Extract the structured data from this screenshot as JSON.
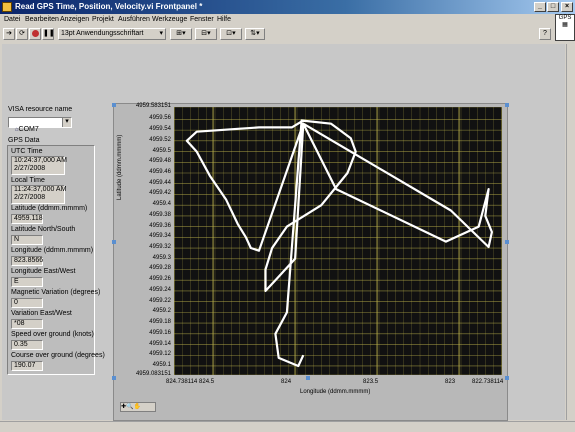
{
  "window": {
    "title": "Read GPS Time, Position, Velocity.vi Frontpanel *"
  },
  "menu": [
    "Datei",
    "Bearbeiten",
    "Anzeigen",
    "Projekt",
    "Ausführen",
    "Werkzeuge",
    "Fenster",
    "Hilfe"
  ],
  "toolbar": {
    "font_label": "13pt Anwendungsschriftart"
  },
  "visa": {
    "label": "VISA resource name",
    "value": "COM7"
  },
  "gps": {
    "cluster_label": "GPS Data",
    "utc_label": "UTC Time",
    "utc_time": "10:24:37,000 AM",
    "utc_date": "2/27/2008",
    "local_label": "Local Time",
    "local_time": "11:24:37,000 AM",
    "local_date": "2/27/2008",
    "lat_label": "Latitude (ddmm.mmmm)",
    "lat_value": "4959.118",
    "lat_ns_label": "Latitude North/South",
    "lat_ns_value": "N",
    "lon_label": "Longitude (ddmm.mmmm)",
    "lon_value": "823.8566",
    "lon_ew_label": "Longitude East/West",
    "lon_ew_value": "E",
    "magvar_label": "Magnetic Variation (degrees)",
    "magvar_value": "0",
    "var_ew_label": "Variation East/West",
    "var_ew_value": "*08",
    "speed_label": "Speed over ground (knots)",
    "speed_value": "0.35",
    "course_label": "Course over ground (degrees)",
    "course_value": "190.07"
  },
  "chart_data": {
    "type": "line",
    "xlabel": "Longitude (ddmm.mmmm)",
    "ylabel": "Latitude (ddmm.mmmm)",
    "xlim": [
      824.738114,
      822.738114
    ],
    "ylim": [
      4959.083151,
      4959.583151
    ],
    "x_ticks": [
      "824.738114",
      "824.5",
      "824",
      "823.5",
      "823",
      "822.738114"
    ],
    "x_tick_values": [
      824.738114,
      824.5,
      824,
      823.5,
      823,
      822.738114
    ],
    "y_ticks": [
      "4959.583151",
      "4959.56",
      "4959.54",
      "4959.52",
      "4959.5",
      "4959.48",
      "4959.46",
      "4959.44",
      "4959.42",
      "4959.4",
      "4959.38",
      "4959.36",
      "4959.34",
      "4959.32",
      "4959.3",
      "4959.28",
      "4959.26",
      "4959.24",
      "4959.22",
      "4959.2",
      "4959.18",
      "4959.16",
      "4959.14",
      "4959.12",
      "4959.1",
      "4959.083151"
    ],
    "y_tick_values": [
      4959.583151,
      4959.56,
      4959.54,
      4959.52,
      4959.5,
      4959.48,
      4959.46,
      4959.44,
      4959.42,
      4959.4,
      4959.38,
      4959.36,
      4959.34,
      4959.32,
      4959.3,
      4959.28,
      4959.26,
      4959.24,
      4959.22,
      4959.2,
      4959.18,
      4959.16,
      4959.14,
      4959.12,
      4959.1,
      4959.083151
    ],
    "grid": true,
    "colors": {
      "plot_bg": "#111111",
      "grid": "#b9b04a",
      "trace": "#ffffff"
    },
    "series": [
      {
        "x": [
          823.95,
          824.02,
          824.22,
          824.6,
          824.66,
          824.6,
          824.52,
          824.42,
          824.35,
          824.3,
          824.27,
          824.22,
          823.95,
          823.05,
          822.82,
          822.8,
          822.84,
          822.82,
          822.88,
          823.08,
          823.75,
          823.95,
          824.0,
          824.12,
          824.18,
          824.18,
          824.14,
          824.05,
          823.84,
          823.68,
          823.63,
          823.66,
          823.78,
          823.96,
          824.05,
          824.12,
          824.1,
          823.98,
          823.95
        ],
        "y": [
          4959.558,
          4959.545,
          4959.545,
          4959.537,
          4959.52,
          4959.5,
          4959.455,
          4959.41,
          4959.365,
          4959.34,
          4959.32,
          4959.315,
          4959.552,
          4959.39,
          4959.322,
          4959.35,
          4959.38,
          4959.43,
          4959.36,
          4959.332,
          4959.43,
          4959.552,
          4959.3,
          4959.26,
          4959.24,
          4959.28,
          4959.32,
          4959.36,
          4959.4,
          4959.46,
          4959.5,
          4959.525,
          4959.552,
          4959.558,
          4959.2,
          4959.16,
          4959.115,
          4959.1,
          4959.12
        ]
      }
    ]
  }
}
